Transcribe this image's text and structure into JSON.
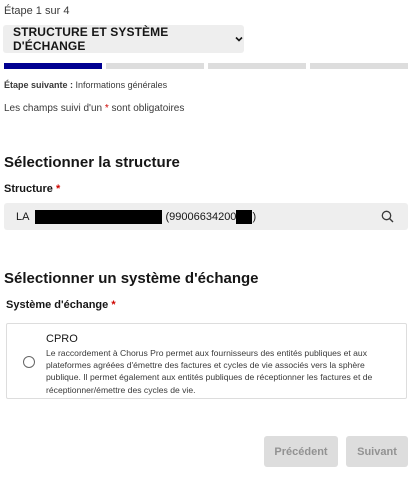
{
  "stepper": {
    "counter": "Étape 1 sur 4",
    "current_step": "STRUCTURE ET SYSTÈME D'ÉCHANGE",
    "next_label": "Étape suivante :",
    "next_value": "Informations générales",
    "total_steps": 4,
    "completed_steps": 1
  },
  "form": {
    "required_note_before": "Les champs suivi d'un",
    "required_note_star": "*",
    "required_note_after": "sont obligatoires"
  },
  "structure_section": {
    "heading": "Sélectionner la structure",
    "field_label": "Structure",
    "required_star": "*",
    "value_prefix": "LA",
    "value_id_part": "(99006634200",
    "value_suffix": ")",
    "search_icon": "search-icon"
  },
  "systeme_section": {
    "heading": "Sélectionner un système d'échange",
    "field_label": "Système d'échange",
    "required_star": "*",
    "option": {
      "title": "CPRO",
      "description": "Le raccordement à Chorus Pro permet aux fournisseurs des entités publiques et aux plateformes agréées d'émettre des factures et cycles de vie associés vers la sphère publique. Il permet également aux entités publiques de réceptionner les factures et de réceptionner/émettre des cycles de vie.",
      "selected": false
    }
  },
  "actions": {
    "previous_label": "Précédent",
    "next_label": "Suivant"
  },
  "colors": {
    "accent": "#000091",
    "required": "#ce0500",
    "field_bg": "#eeeeee",
    "disabled_bg": "#dddddd",
    "disabled_text": "#929292"
  }
}
